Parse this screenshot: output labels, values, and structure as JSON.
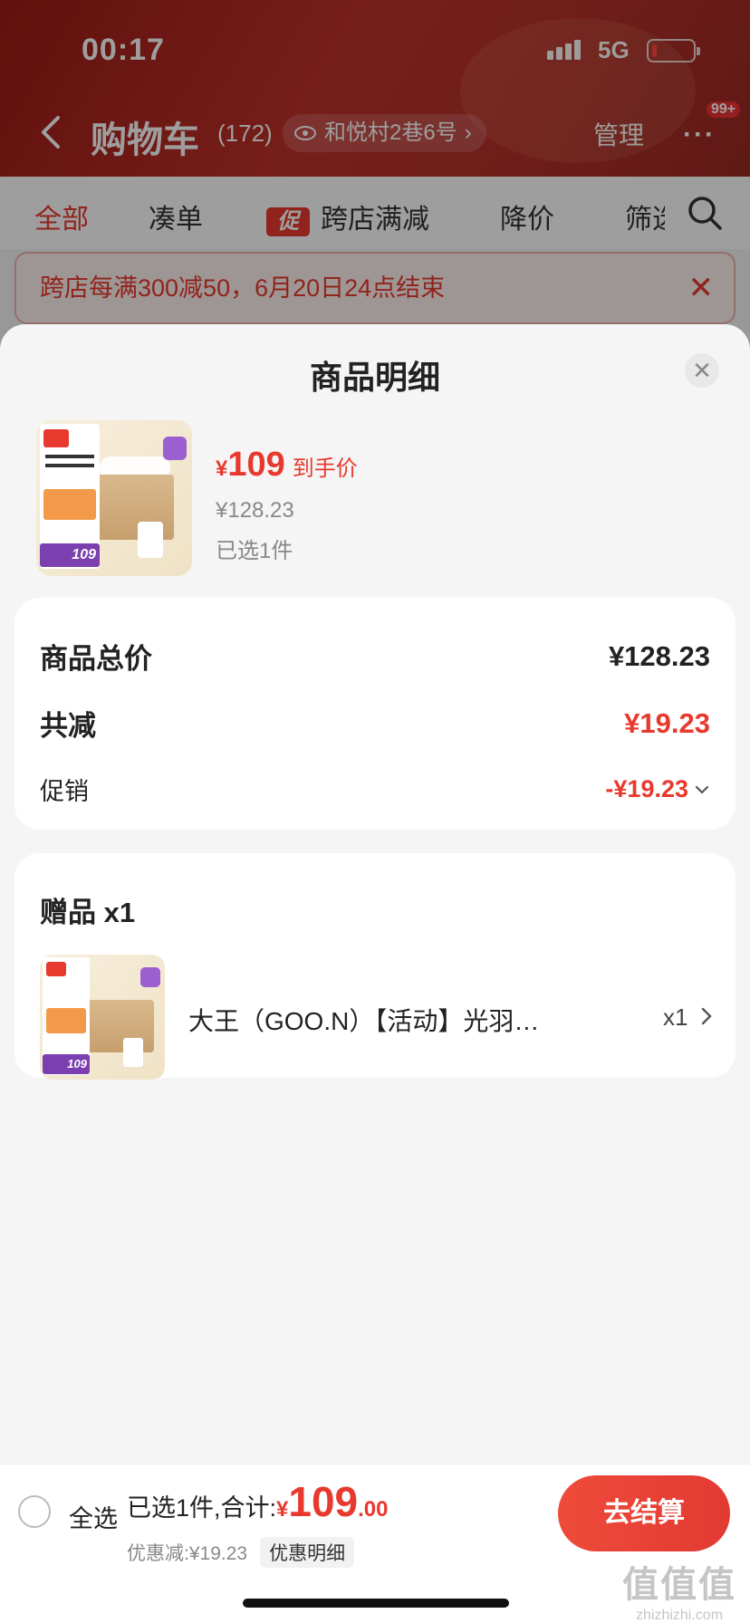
{
  "status_bar": {
    "time": "00:17",
    "network": "5G"
  },
  "nav": {
    "title": "购物车",
    "count": "(172)",
    "address": "和悦村2巷6号",
    "manage": "管理",
    "more_badge": "99+"
  },
  "filter_tabs": [
    {
      "label": "全部",
      "active": true
    },
    {
      "label": "凑单"
    },
    {
      "label": "跨店满减",
      "tag": "促"
    },
    {
      "label": "降价"
    },
    {
      "label": "筛选"
    }
  ],
  "promo_banner": {
    "text": "跨店每满300减50，6月20日24点结束"
  },
  "sheet": {
    "title": "商品明细",
    "product": {
      "thumb_price": "109",
      "price_symbol": "¥",
      "price": "109",
      "price_label": "到手价",
      "original_price": "¥128.23",
      "selected_count": "已选1件"
    },
    "summary": {
      "total_label": "商品总价",
      "total_value": "¥128.23",
      "reduce_label": "共减",
      "reduce_value": "¥19.23",
      "promo_label": "促销",
      "promo_value": "-¥19.23"
    },
    "gift": {
      "header": "赠品 x1",
      "name": "大王（GOO.N）【活动】光羽…",
      "qty": "x1",
      "thumb_price": "109"
    }
  },
  "bottom_bar": {
    "select_all": "全选",
    "summary_text": "已选1件,合计:",
    "currency": "¥",
    "total_int": "109",
    "total_dec": ".00",
    "discount_text": "优惠减:¥19.23",
    "discount_detail": "优惠明细",
    "checkout": "去结算"
  },
  "watermark": {
    "line1": "值值值",
    "line2": "zhizhizhi.com"
  },
  "colors": {
    "accent": "#e8392e",
    "header_red": "#b5302a"
  }
}
